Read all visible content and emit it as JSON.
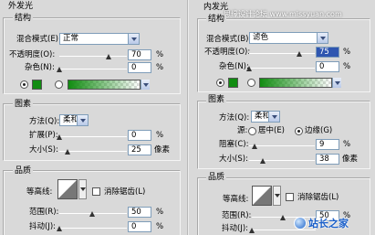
{
  "left": {
    "title": "外发光",
    "structure": {
      "title": "结构",
      "blend_label": "混合模式(E):",
      "blend_value": "正常",
      "opacity_label": "不透明度(O):",
      "opacity_value": "70",
      "noise_label": "杂色(N):",
      "noise_value": "0",
      "percent": "%"
    },
    "elements": {
      "title": "图素",
      "method_label": "方法(Q):",
      "method_value": "柔和",
      "spread_label": "扩展(P):",
      "spread_value": "0",
      "size_label": "大小(S):",
      "size_value": "25",
      "px_unit": "像素",
      "percent": "%"
    },
    "quality": {
      "title": "品质",
      "contour_label": "等高线:",
      "antialias_label": "消除锯齿(L)",
      "range_label": "范围(R):",
      "range_value": "50",
      "jitter_label": "抖动(J):",
      "jitter_value": "0",
      "percent": "%"
    }
  },
  "right": {
    "title": "内发光",
    "watermark": "思缘设计论坛 www.missyuan.com",
    "structure": {
      "title": "结构",
      "blend_label": "混合模式(B):",
      "blend_value": "滤色",
      "opacity_label": "不透明度(O):",
      "opacity_value": "75",
      "noise_label": "杂色(N):",
      "noise_value": "0",
      "percent": "%"
    },
    "elements": {
      "title": "图素",
      "method_label": "方法(Q):",
      "method_value": "柔和",
      "source_label": "源:",
      "center_label": "居中(E)",
      "edge_label": "边缘(G)",
      "choke_label": "阻塞(C):",
      "choke_value": "9",
      "size_label": "大小(S):",
      "size_value": "38",
      "px_unit": "像素",
      "percent": "%"
    },
    "quality": {
      "title": "品质",
      "contour_label": "等高线:",
      "antialias_label": "消除锯齿(L)",
      "range_label": "范围(R):",
      "range_value": "50",
      "jitter_label": "抖动(J):",
      "jitter_value": "",
      "percent": "%"
    },
    "logo_text": "站长之家"
  },
  "colors": {
    "glow": "#118c11",
    "selection": "#2f56b0"
  }
}
